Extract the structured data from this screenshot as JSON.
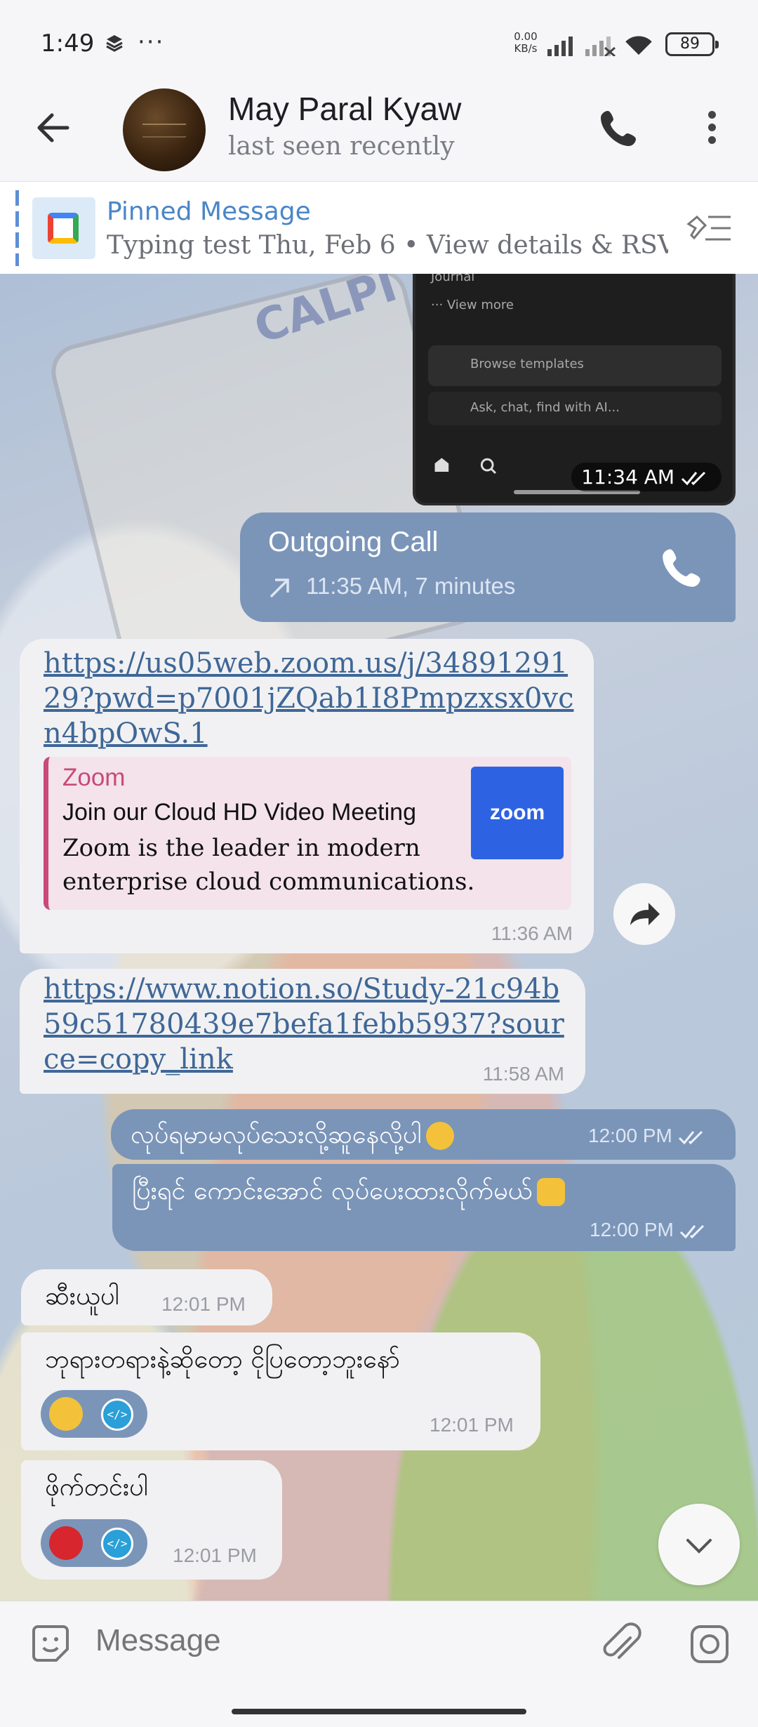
{
  "status_bar": {
    "time": "1:49",
    "stack_icon": "layers-icon",
    "overflow": "···",
    "speed_value": "0.00",
    "speed_unit": "KB/s",
    "battery": "89"
  },
  "header": {
    "name": "May Paral Kyaw",
    "status": "last seen recently"
  },
  "pinned": {
    "title": "Pinned Message",
    "text": "Typing test Thu, Feb 6  •  View details & RSV..."
  },
  "image_message": {
    "rows": [
      "Journal",
      "··· View more"
    ],
    "browse": "Browse templates",
    "ask": "Ask, chat, find with AI...",
    "time": "11:34 AM"
  },
  "call": {
    "title": "Outgoing Call",
    "detail": "11:35 AM, 7 minutes"
  },
  "zoom_message": {
    "link": "https://us05web.zoom.us/j/3489129129?pwd=p7001jZQab1I8Pmpzxsx0vcn4bpOwS.1",
    "site": "Zoom",
    "title": "Join our Cloud HD Video Meeting",
    "desc": "Zoom is the leader in modern enterprise cloud communications.",
    "logo": "zoom",
    "time": "11:36 AM"
  },
  "notion_message": {
    "link": "https://www.notion.so/Study-21c94b59c51780439e7befa1febb5937?source=copy_link",
    "time": "11:58 AM"
  },
  "outgoing": [
    {
      "text": "လုပ်ရမာမလုပ်သေးလို့ဆူနေလို့ပါ",
      "emoji": "shushing-face",
      "time": "12:00 PM"
    },
    {
      "text": "ပြီးရင် ကောင်းအောင် လုပ်ပေးထားလိုက်မယ်",
      "emoji": "crossed-fingers",
      "time": "12:00 PM"
    }
  ],
  "incoming": [
    {
      "text": "ဆီးယူပါ",
      "time": "12:01 PM"
    },
    {
      "text": "ဘုရားတရားနဲ့ဆိုတော့ ငိုပြတော့ဘူးနော်",
      "reaction": "grinning-face",
      "time": "12:01 PM"
    },
    {
      "text": "ဖိုက်တင်းပါ",
      "reaction": "strawberry",
      "time": "12:01 PM"
    }
  ],
  "code_badge": "</>",
  "input": {
    "placeholder": "Message"
  },
  "colors": {
    "outgoing_bubble": "#7b95b9",
    "incoming_bubble": "#f1f1f3",
    "link": "#3f6797",
    "zoom_accent": "#c84a78",
    "zoom_logo_bg": "#2d63e3"
  }
}
